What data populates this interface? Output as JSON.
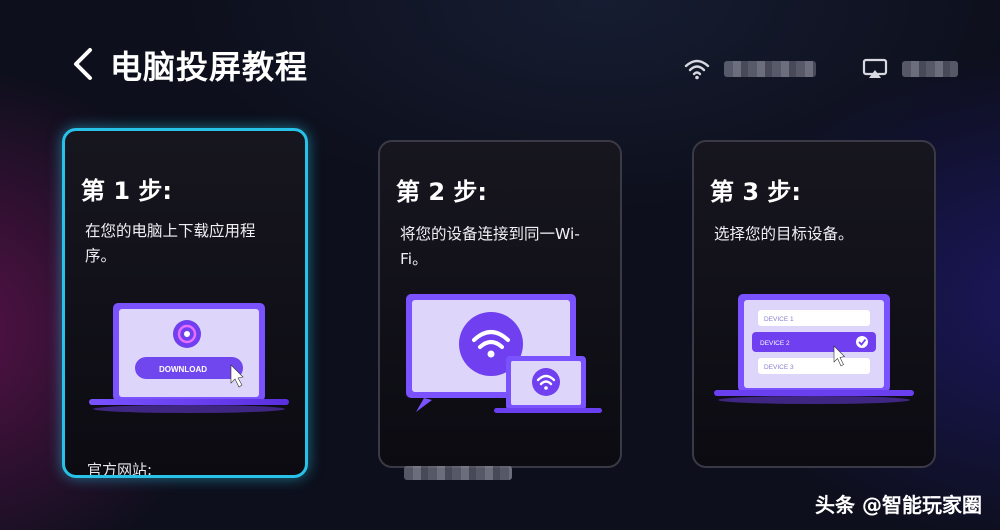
{
  "header": {
    "title": "电脑投屏教程",
    "back_icon": "chevron-left-icon",
    "wifi_icon": "wifi-icon",
    "cast_icon": "screen-cast-icon"
  },
  "steps": [
    {
      "title": "第 1 步:",
      "description": "在您的电脑上下载应用程序。",
      "illustration": "laptop-download",
      "button_label": "DOWNLOAD",
      "active": true,
      "footer_label": "官方网站:"
    },
    {
      "title": "第 2 步:",
      "description": "将您的设备连接到同一Wi-Fi。",
      "illustration": "tv-and-laptop-wifi",
      "active": false
    },
    {
      "title": "第 3 步:",
      "description": "选择您的目标设备。",
      "illustration": "laptop-device-list",
      "active": false,
      "devices": [
        "DEVICE 1",
        "DEVICE 2",
        "DEVICE 3"
      ]
    }
  ],
  "watermark": "头条 @智能玩家圈",
  "colors": {
    "accent": "#28c2e8",
    "purple": "#6f3ff0",
    "screen": "#d8d2f7"
  }
}
